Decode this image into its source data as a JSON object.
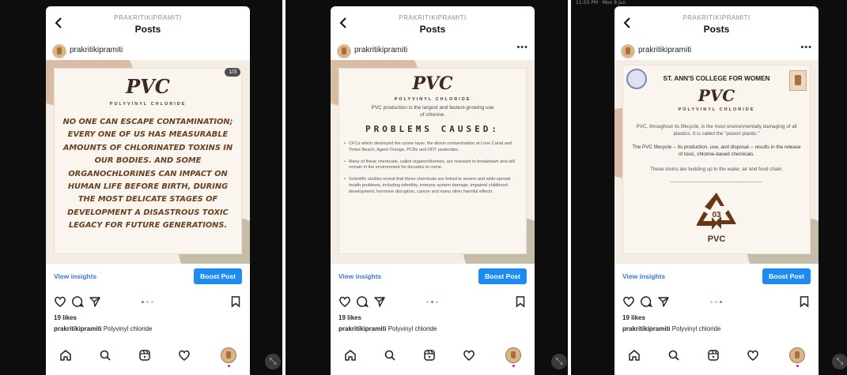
{
  "screens": [
    {
      "header": {
        "username_small": "PRAKRITIKIPRAMITI",
        "title": "Posts"
      },
      "post_user": "prakritikipramiti",
      "counter": "1/3",
      "pvc_title": "PVC",
      "pvc_subtitle": "POLYVINYL CHLORIDE",
      "quote": "NO ONE CAN ESCAPE CONTAMINATION; EVERY ONE OF US HAS MEASURABLE AMOUNTS OF CHLORINATED TOXINS IN OUR BODIES. AND SOME ORGANOCHLORINES CAN IMPACT ON HUMAN LIFE BEFORE BIRTH, DURING THE MOST DELICATE STAGES OF DEVELOPMENT A DISASTROUS TOXIC LEGACY FOR FUTURE GENERATIONS."
    },
    {
      "header": {
        "username_small": "PRAKRITIKIPRAMITI",
        "title": "Posts"
      },
      "post_user": "prakritikipramiti",
      "pvc_title": "PVC",
      "pvc_subtitle": "POLYVINYL CHLORIDE",
      "intro": "PVC production is the largest and fastest-growing use of chlorine.",
      "heading": "PROBLEMS CAUSED:",
      "bullets": [
        "CFCs which destroyed the ozone layer, the dioxin contamination at Love Canal and Times Beach, Agent Orange, PCBs and DDT pesticides.",
        "Many of these chemicals, called organochlorines, are resistant to breakdown and will remain in the environment for decades to come.",
        "Scientific studies reveal that these chemicals are linked to severe and wide-spread health problems, including infertility, immune system damage, impaired childhood development, hormone disruption, cancer and many other harmful effects."
      ]
    },
    {
      "header": {
        "username_small": "PRAKRITIKIPRAMITI",
        "title": "Posts"
      },
      "post_user": "prakritikipramiti",
      "college": "ST. ANN'S COLLEGE FOR WOMEN",
      "pvc_title": "PVC",
      "pvc_subtitle": "POLYVINYL CHLORIDE",
      "para1": "PVC, throughout its lifecycle, is the most environmentally damaging of all plastics. It is called the \"poison plastic.\"",
      "para2": "The PVC lifecycle -- its production, use, and disposal -- results in the release of toxic, chlorine-based chemicals.",
      "para3": "These toxins are building up in the water, air and food chain.",
      "recycle_code": "03",
      "recycle_label": "PVC"
    }
  ],
  "common": {
    "view_insights": "View insights",
    "boost_post": "Boost Post",
    "likes": "19 likes",
    "caption_user": "prakritikipramiti",
    "caption_text": " Polyvinyl chloride"
  },
  "system_bar_text": "11:50 PM · Mon 8 Jun",
  "colors": {
    "accent_blue": "#1d8cf2",
    "link_blue": "#3a79d1",
    "text_brown": "#6b3f1f"
  }
}
